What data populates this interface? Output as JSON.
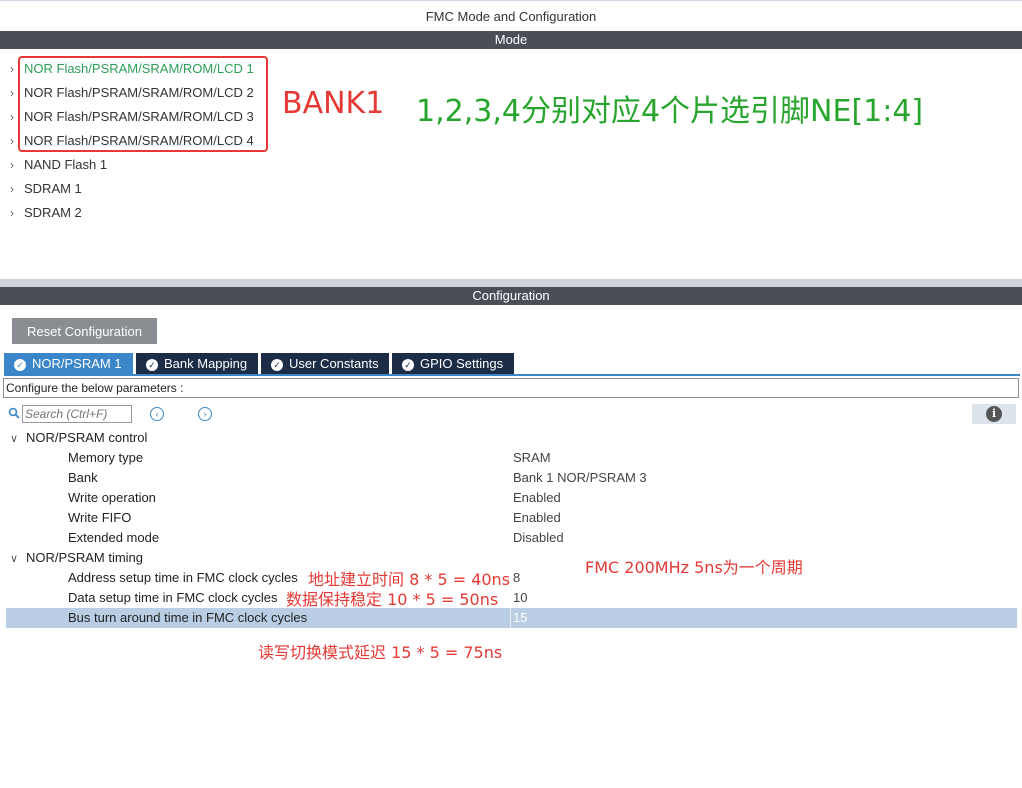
{
  "window": {
    "title": "FMC Mode and Configuration"
  },
  "mode": {
    "band_label": "Mode",
    "items": [
      {
        "label": "NOR Flash/PSRAM/SRAM/ROM/LCD 1"
      },
      {
        "label": "NOR Flash/PSRAM/SRAM/ROM/LCD 2"
      },
      {
        "label": "NOR Flash/PSRAM/SRAM/ROM/LCD 3"
      },
      {
        "label": "NOR Flash/PSRAM/SRAM/ROM/LCD 4"
      },
      {
        "label": "NAND Flash 1"
      },
      {
        "label": "SDRAM 1"
      },
      {
        "label": "SDRAM 2"
      }
    ]
  },
  "annotations": {
    "bank": "BANK1",
    "ne": "1,2,3,4分别对应4个片选引脚NE[1:4]",
    "fmc_clock": "FMC 200MHz 5ns为一个周期",
    "address_setup": "地址建立时间 8 * 5 = 40ns",
    "data_setup": "数据保持稳定 10 * 5 = 50ns",
    "bus_turn": "读写切换模式延迟 15 * 5 = 75ns"
  },
  "configuration": {
    "band_label": "Configuration",
    "reset_label": "Reset Configuration",
    "tabs": [
      {
        "label": "NOR/PSRAM 1"
      },
      {
        "label": "Bank Mapping"
      },
      {
        "label": "User Constants"
      },
      {
        "label": "GPIO Settings"
      }
    ],
    "configure_label": "Configure the below parameters :",
    "search_placeholder": "Search (Ctrl+F)",
    "info_glyph": "i",
    "groups": {
      "control": "NOR/PSRAM control",
      "timing": "NOR/PSRAM timing"
    },
    "params": [
      {
        "name": "Memory type",
        "value": "SRAM"
      },
      {
        "name": "Bank",
        "value": "Bank 1 NOR/PSRAM 3"
      },
      {
        "name": "Write operation",
        "value": "Enabled"
      },
      {
        "name": "Write FIFO",
        "value": "Enabled"
      },
      {
        "name": "Extended mode",
        "value": "Disabled"
      },
      {
        "name": "Address setup time in FMC clock cycles",
        "value": "8"
      },
      {
        "name": "Data setup time in FMC clock cycles",
        "value": "10"
      },
      {
        "name": "Bus turn around time in FMC clock cycles",
        "value": "15"
      }
    ]
  }
}
